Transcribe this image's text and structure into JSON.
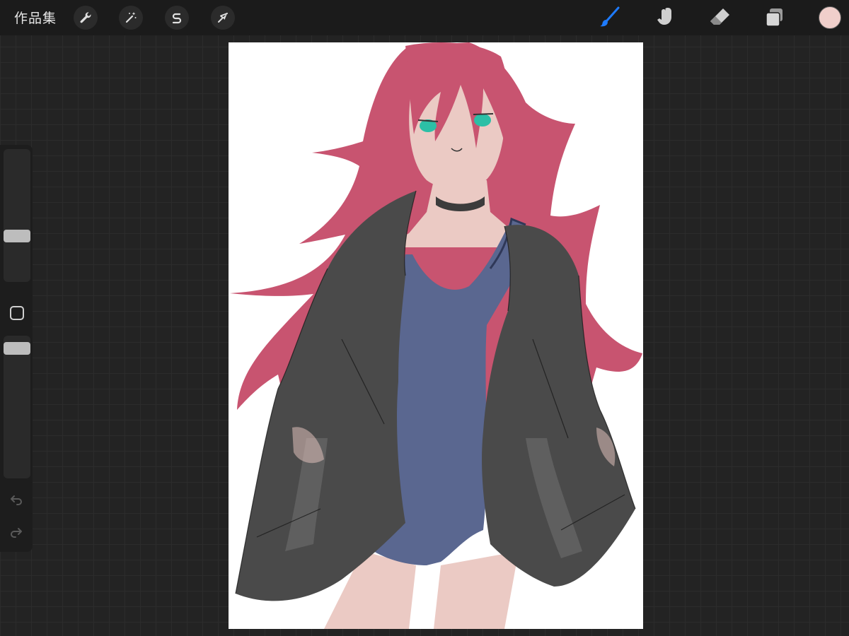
{
  "toolbar": {
    "gallery_label": "作品集",
    "left_tools": [
      {
        "name": "actions",
        "icon": "wrench-icon"
      },
      {
        "name": "adjustments",
        "icon": "magic-wand-icon"
      },
      {
        "name": "selection",
        "icon": "selection-s-icon"
      },
      {
        "name": "transform",
        "icon": "arrow-cursor-icon"
      }
    ],
    "right_tools": [
      {
        "name": "brush",
        "icon": "brush-icon",
        "active": true
      },
      {
        "name": "smudge",
        "icon": "smudge-finger-icon",
        "active": false
      },
      {
        "name": "eraser",
        "icon": "eraser-icon",
        "active": false
      },
      {
        "name": "layers",
        "icon": "layers-icon",
        "active": false
      }
    ],
    "current_color": "#f0cfcb",
    "accent_color": "#1e7bff"
  },
  "sidebar": {
    "brush_size_level": 0.33,
    "opacity_level": 0.95
  }
}
